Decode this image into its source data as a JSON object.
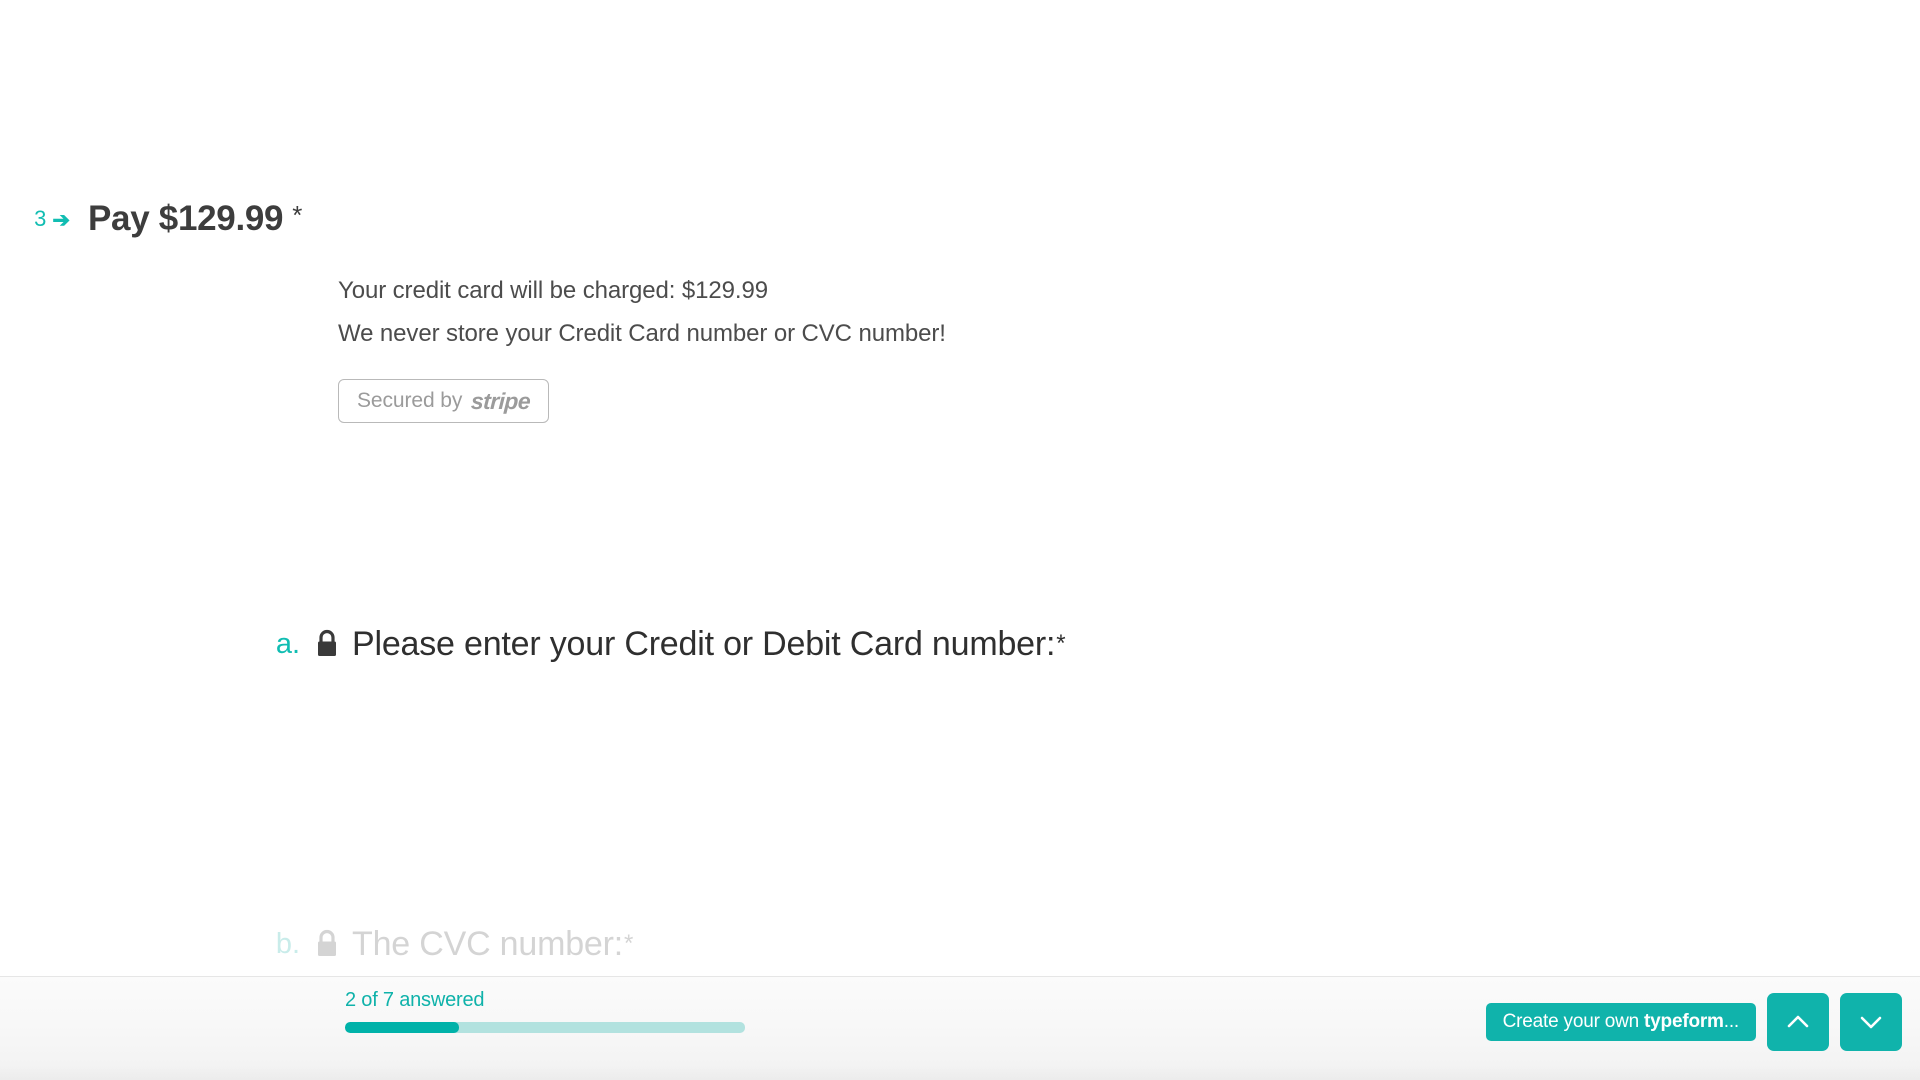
{
  "form": {
    "accent_color": "#11bdb2",
    "text_color": "#3d3d3d"
  },
  "question_pay": {
    "number": "3",
    "arrow_icon": "arrow-right-icon",
    "title": "Pay $129.99",
    "required_marker": "*",
    "description_line_1": "Your credit card will be charged: $129.99",
    "description_line_2": "We never store your Credit Card number or CVC number!",
    "stripe_badge": {
      "prefix": "Secured by",
      "logo": "stripe"
    }
  },
  "sub_question_a": {
    "letter": "a.",
    "lock_icon": "lock-icon",
    "title": "Please enter your Credit or Debit Card number:",
    "required_marker": "*"
  },
  "sub_question_b": {
    "letter": "b.",
    "lock_icon": "lock-icon",
    "title": "The CVC number:",
    "required_marker": "*"
  },
  "footer": {
    "progress_text": "2 of 7 answered",
    "progress_answered": 2,
    "progress_total": 7,
    "progress_percent": 28.5,
    "cta_prefix": "Create your own",
    "cta_brand": "typeform",
    "cta_suffix": "...",
    "nav_up_icon": "chevron-up-icon",
    "nav_down_icon": "chevron-down-icon",
    "accent_color": "#10b3ab",
    "progress_color": "#00b2a9",
    "progress_track_color": "#b2e2df"
  }
}
